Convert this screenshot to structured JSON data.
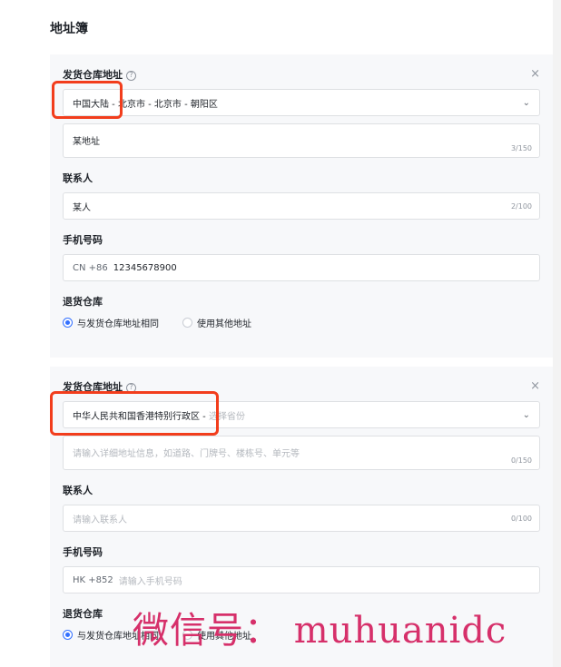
{
  "page": {
    "title": "地址簿"
  },
  "cards": [
    {
      "warehouse_label": "发货仓库地址",
      "help_icon": "?",
      "close_icon": "×",
      "region_value": "中国大陆 - 北京市 - 北京市 - 朝阳区",
      "chevron_icon": "⌄",
      "detail_value": "某地址",
      "detail_counter": "3/150",
      "contact_label": "联系人",
      "contact_value": "某人",
      "contact_counter": "2/100",
      "phone_label": "手机号码",
      "phone_prefix": "CN +86",
      "phone_value": "12345678900",
      "return_label": "退货仓库",
      "return_option_same": "与发货仓库地址相同",
      "return_option_other": "使用其他地址"
    },
    {
      "warehouse_label": "发货仓库地址",
      "help_icon": "?",
      "close_icon": "×",
      "region_value": "中华人民共和国香港特别行政区 -",
      "region_placeholder": "选择省份",
      "chevron_icon": "⌄",
      "detail_placeholder": "请输入详细地址信息，如道路、门牌号、楼栋号、单元等",
      "detail_counter": "0/150",
      "contact_label": "联系人",
      "contact_placeholder": "请输入联系人",
      "contact_counter": "0/100",
      "phone_label": "手机号码",
      "phone_prefix": "HK +852",
      "phone_placeholder": "请输入手机号码",
      "return_label": "退货仓库",
      "return_option_same": "与发货仓库地址相同",
      "return_option_other": "使用其他地址"
    }
  ],
  "watermark": "微信号： muhuanidc",
  "colors": {
    "highlight": "#f23d1c",
    "radio_accent": "#3370ff",
    "watermark": "#d6306a"
  }
}
